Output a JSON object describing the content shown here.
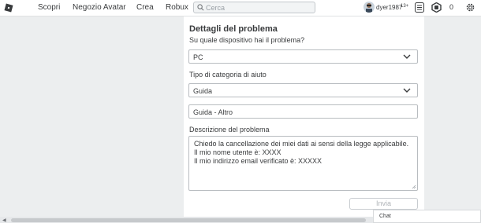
{
  "nav": {
    "items": [
      "Scopri",
      "Negozio Avatar",
      "Crea",
      "Robux"
    ],
    "search_placeholder": "Cerca"
  },
  "user": {
    "name": "dyer1987",
    "age_badge": "13+",
    "robux": "0"
  },
  "form": {
    "title": "Dettagli del problema",
    "device_label": "Su quale dispositivo hai il problema?",
    "device_value": "PC",
    "category_label": "Tipo di categoria di aiuto",
    "category_value": "Guida",
    "subcategory_value": "Guida - Altro",
    "description_label": "Descrizione del problema",
    "description_lines": [
      "Chiedo la cancellazione dei miei dati ai sensi della legge applicabile.",
      "Il mio nome utente è: XXXX",
      "Il mio indirizzo email verificato è: XXXXX"
    ],
    "submit_label": "Invia"
  },
  "chat": {
    "label": "Chat"
  },
  "colors": {
    "accent": "#393b3d",
    "background": "#eceeef",
    "card": "#ffffff"
  },
  "icons": [
    "roblox-logo-icon",
    "search-icon",
    "chevron-down-icon",
    "notifications-icon",
    "robux-icon",
    "gear-icon"
  ]
}
